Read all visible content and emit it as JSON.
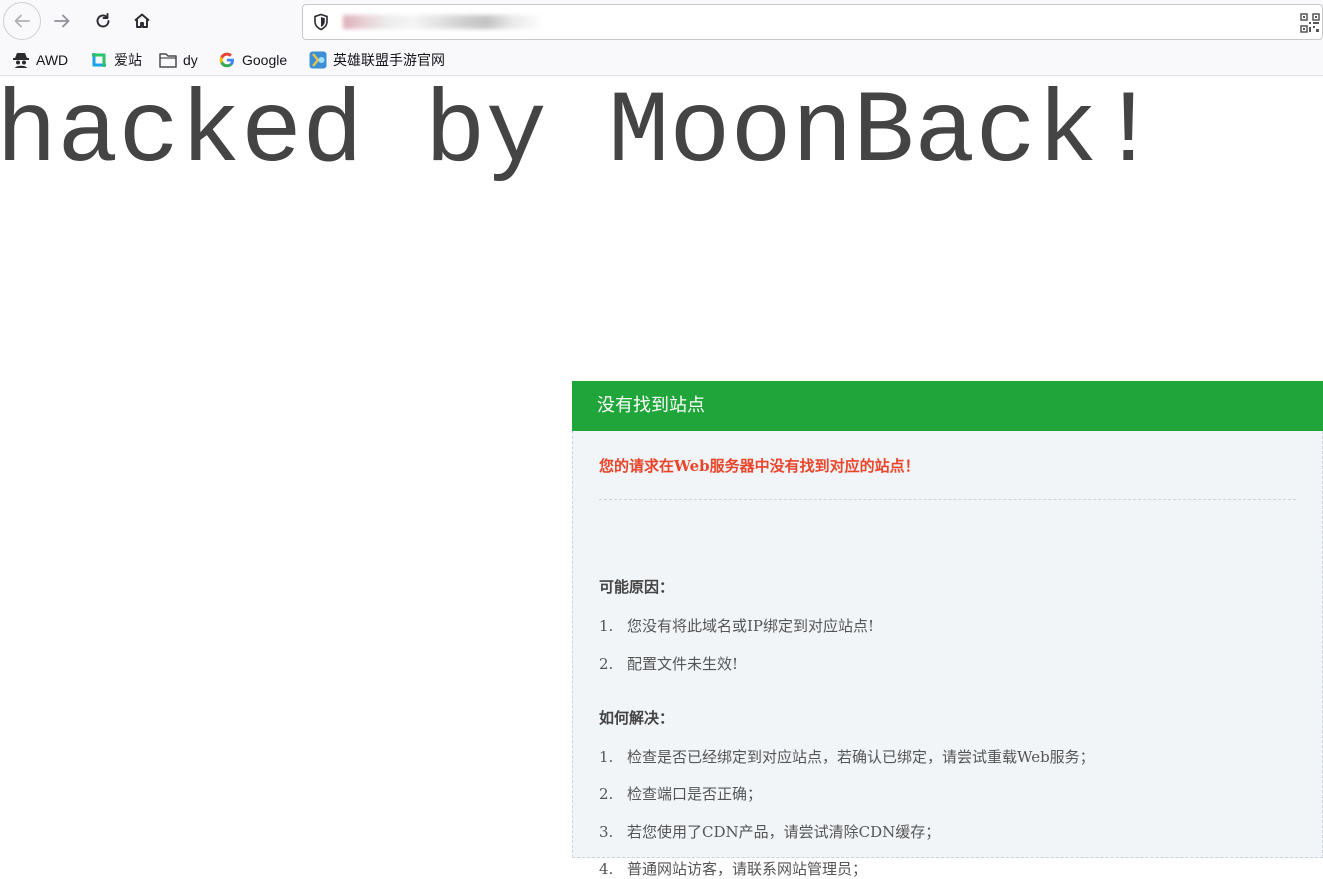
{
  "browser": {
    "url": "",
    "bookmarks": [
      {
        "label": "AWD",
        "icon": "spy-icon"
      },
      {
        "label": "爱站",
        "icon": "aizhan-icon"
      },
      {
        "label": "dy",
        "icon": "folder-icon"
      },
      {
        "label": "Google",
        "icon": "google-icon"
      },
      {
        "label": "英雄联盟手游官网",
        "icon": "lol-icon"
      }
    ]
  },
  "page": {
    "hacked_text": "hacked by MoonBack!"
  },
  "error_card": {
    "header": "没有找到站点",
    "error_message": "您的请求在Web服务器中没有找到对应的站点！",
    "reasons_title": "可能原因：",
    "reasons": [
      {
        "num": "1.",
        "text": "您没有将此域名或IP绑定到对应站点!"
      },
      {
        "num": "2.",
        "text": "配置文件未生效!"
      }
    ],
    "solutions_title": "如何解决：",
    "solutions": [
      {
        "num": "1.",
        "text": "检查是否已经绑定到对应站点，若确认已绑定，请尝试重载Web服务；"
      },
      {
        "num": "2.",
        "text": "检查端口是否正确；"
      },
      {
        "num": "3.",
        "text": "若您使用了CDN产品，请尝试清除CDN缓存；"
      },
      {
        "num": "4.",
        "text": "普通网站访客，请联系网站管理员；"
      }
    ],
    "colors": {
      "header": "#20a53a",
      "error": "#e9452b",
      "body_bg": "#f2f5f8"
    }
  }
}
